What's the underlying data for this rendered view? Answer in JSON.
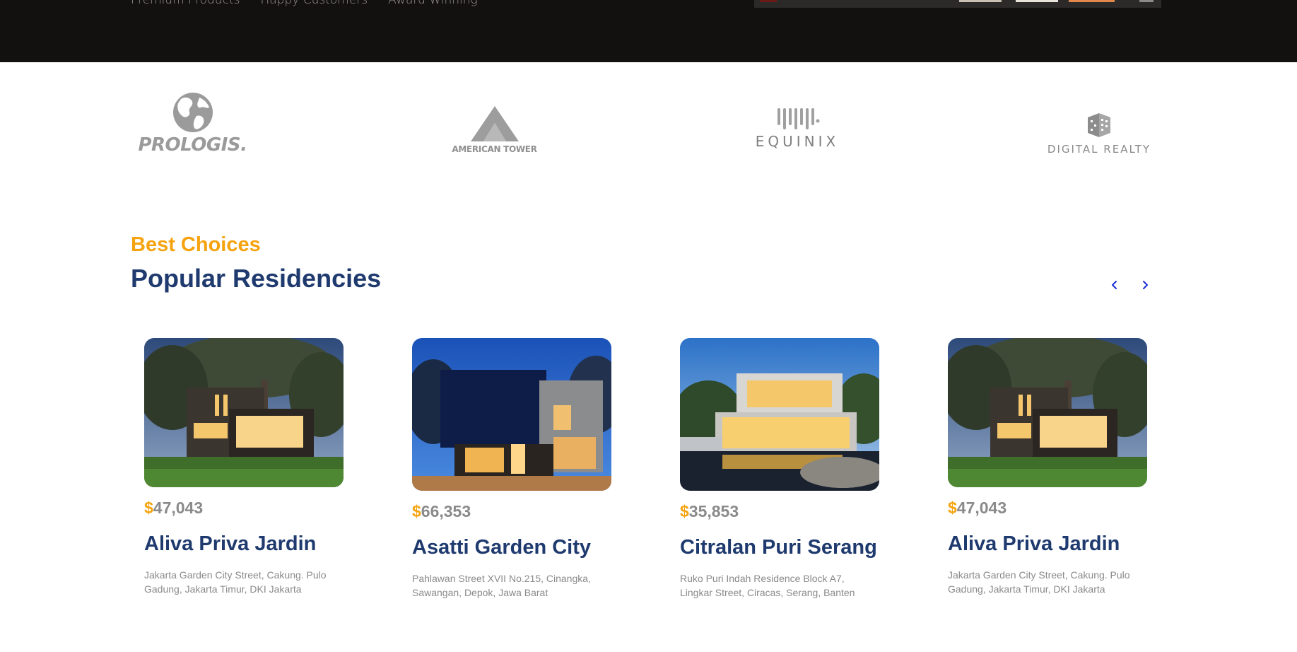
{
  "hero": {
    "stats": [
      "Premium Products",
      "Happy Customers",
      "Award Winning"
    ]
  },
  "partners": {
    "logos": [
      {
        "name": "PROLOGIS.",
        "icon": "globe-icon"
      },
      {
        "name": "AMERICAN TOWER",
        "icon": "tower-triangle-icon"
      },
      {
        "name": "EQUINIX",
        "icon": "equinix-bars-icon"
      },
      {
        "name": "DIGITAL REALTY",
        "icon": "cube-icon"
      }
    ]
  },
  "section": {
    "eyebrow": "Best Choices",
    "title": "Popular Residencies"
  },
  "carousel": {
    "prev_icon": "chevron-left-icon",
    "next_icon": "chevron-right-icon"
  },
  "cards": [
    {
      "currency": "$",
      "price": "47,043",
      "name": "Aliva Priva Jardin",
      "address": "Jakarta Garden City Street, Cakung. Pulo Gadung, Jakarta Timur, DKI Jakarta"
    },
    {
      "currency": "$",
      "price": "66,353",
      "name": "Asatti Garden City",
      "address": "Pahlawan Street XVII No.215, Cinangka, Sawangan, Depok, Jawa Barat"
    },
    {
      "currency": "$",
      "price": "35,853",
      "name": "Citralan Puri Serang",
      "address": "Ruko Puri Indah Residence Block A7, Lingkar Street, Ciracas, Serang, Banten"
    },
    {
      "currency": "$",
      "price": "47,043",
      "name": "Aliva Priva Jardin",
      "address": "Jakarta Garden City Street, Cakung. Pulo Gadung, Jakarta Timur, DKI Jakarta"
    }
  ],
  "colors": {
    "accent": "#f5a30f",
    "heading": "#1f3a6e",
    "hero_bg": "#131110",
    "muted": "#8a8a8a"
  }
}
